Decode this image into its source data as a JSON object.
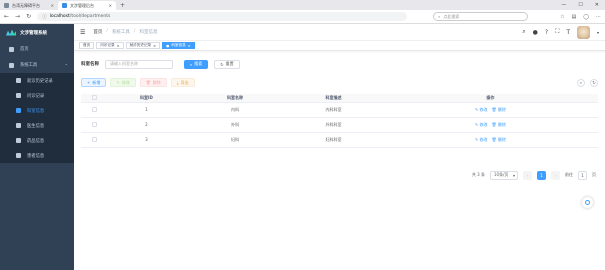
{
  "browser": {
    "tabs": [
      {
        "title": "台湾无障碍平台",
        "active": false
      },
      {
        "title": "文涉管理后台",
        "active": true
      }
    ],
    "url_host": "localhost",
    "url_path": "/tool/departments",
    "search_placeholder": "点此搜索"
  },
  "sidebar": {
    "title": "文涉管理系统",
    "items": [
      {
        "label": "首页"
      },
      {
        "label": "系统工具"
      }
    ],
    "subitems": [
      {
        "label": "就诊历史记录"
      },
      {
        "label": "问诊记录"
      },
      {
        "label": "科室信息"
      },
      {
        "label": "医生信息"
      },
      {
        "label": "药品信息"
      },
      {
        "label": "患者信息"
      }
    ]
  },
  "breadcrumb": [
    "首页",
    "系统工具",
    "科室信息"
  ],
  "tags": [
    {
      "label": "首页",
      "active": false
    },
    {
      "label": "问诊记录",
      "active": false
    },
    {
      "label": "就诊历史记录",
      "active": false
    },
    {
      "label": "科室信息",
      "active": true
    }
  ],
  "search": {
    "label": "科室名称",
    "placeholder": "请输入科室名称",
    "search_btn": "搜索",
    "reset_btn": "重置"
  },
  "toolbar": {
    "add": "新增",
    "edit": "修改",
    "delete": "删除",
    "export": "导出"
  },
  "table": {
    "headers": [
      "科室ID",
      "科室名称",
      "科室描述",
      "操作"
    ],
    "rows": [
      {
        "id": "1",
        "name": "内科",
        "desc": "内科科室"
      },
      {
        "id": "2",
        "name": "外科",
        "desc": "外科科室"
      },
      {
        "id": "3",
        "name": "妇科",
        "desc": "妇科科室"
      }
    ],
    "edit_label": "修改",
    "delete_label": "删除"
  },
  "pagination": {
    "total": "共 3 条",
    "page_size": "10条/页",
    "current_page": "1",
    "goto_label": "前往",
    "goto_value": "1",
    "page_suffix": "页"
  }
}
